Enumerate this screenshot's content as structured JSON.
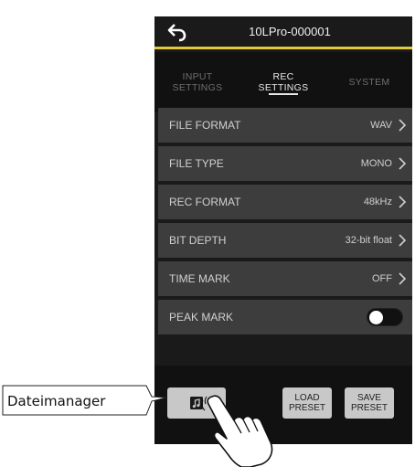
{
  "header": {
    "title": "10LPro-000001",
    "back_icon": "back-arrow-icon"
  },
  "tabs": [
    {
      "line1": "INPUT",
      "line2": "SETTINGS",
      "active": false
    },
    {
      "line1": "REC",
      "line2": "SETTINGS",
      "active": true
    },
    {
      "line1": "SYSTEM",
      "line2": "",
      "active": false
    }
  ],
  "settings": [
    {
      "label": "FILE FORMAT",
      "value": "WAV"
    },
    {
      "label": "FILE TYPE",
      "value": "MONO"
    },
    {
      "label": "REC FORMAT",
      "value": "48kHz"
    },
    {
      "label": "BIT DEPTH",
      "value": "32-bit float"
    },
    {
      "label": "TIME MARK",
      "value": "OFF"
    },
    {
      "label": "PEAK MARK",
      "toggle_on": false
    }
  ],
  "bottom": {
    "file_manager_icon": "music-file-icon",
    "load_preset": {
      "line1": "LOAD",
      "line2": "PRESET"
    },
    "save_preset": {
      "line1": "SAVE",
      "line2": "PRESET"
    }
  },
  "callout": {
    "text": "Dateimanager"
  },
  "colors": {
    "accent": "#e2c93a",
    "row_bg": "#3d3d3d",
    "screen_bg": "#1a1a1a",
    "button_bg": "#c8c8c8"
  }
}
